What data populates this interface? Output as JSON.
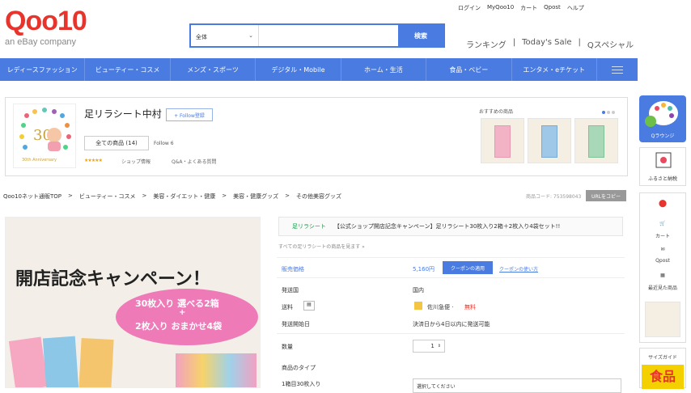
{
  "header": {
    "logo_text": "Qoo10",
    "logo_sub": "an eBay company",
    "search": {
      "category": "全体",
      "placeholder": "",
      "button": "検索"
    },
    "toplinks": [
      "ログイン",
      "MyQoo10",
      "カート",
      "Qpost",
      "ヘルプ"
    ],
    "sublinks": [
      "ランキング",
      "|",
      "Today's Sale",
      "|",
      "Qスペシャル"
    ]
  },
  "nav": {
    "items": [
      "レディースファッション",
      "ビューティー・コスメ",
      "メンズ・スポーツ",
      "デジタル・Mobile",
      "ホーム・生活",
      "食品・ベビー",
      "エンタメ・eチケット"
    ]
  },
  "shop": {
    "name": "足リラシート中村",
    "follow_button": "+ Follow登録",
    "all_items": "全ての商品 (14)",
    "follow": "Follow 6",
    "stars": "★★★★★",
    "shop_info": "ショップ情報",
    "qa": "Q&A・よくある質問",
    "reco_label": "おすすめの商品",
    "logo_badge": "30th Anniversary"
  },
  "rightbar": {
    "qlounge": "Qラウンジ",
    "furusato": "ふるさと納税",
    "tools": [
      "カート",
      "Qpost",
      "最近見た商品"
    ],
    "size_guide": "サイズガイド",
    "food": "食品"
  },
  "breadcrumb": [
    "Qoo10ネット通販TOP",
    ">",
    "ビューティー・コスメ",
    ">",
    "美容・ダイエット・健康",
    ">",
    "美容・健康グッズ",
    ">",
    "その他美容グッズ"
  ],
  "product": {
    "code": "商品コード: 753598043",
    "url_copy": "URLをコピー",
    "shop_tag": "足リラシート",
    "title": "【公式ショップ開店記念キャンペーン】足リラシート30枚入り2箱＋2枚入り4袋セット!!",
    "see_all": "すべての足リラシートの商品を見ます »",
    "price_label": "販売価格",
    "price": "5,160円",
    "coupon_btn": "クーポンの適用",
    "coupon_link": "クーポンの使い方",
    "ship_from_label": "発送国",
    "ship_from": "国内",
    "shipping_label": "送料",
    "shipping_carrier": "佐川急便 ·",
    "shipping_free": "無料",
    "ship_start_label": "発送開始日",
    "ship_start": "決済日から4日以内に発送可能",
    "qty_label": "数量",
    "qty": "1",
    "type_label": "商品のタイプ",
    "variant_label": "1箱目30枚入り",
    "variant_select": "選択してください",
    "banner_title": "開店記念キャンペーン！",
    "banner_line1": "30枚入り 選べる2箱",
    "banner_plus": "+",
    "banner_line2": "2枚入り おまかせ4袋"
  }
}
